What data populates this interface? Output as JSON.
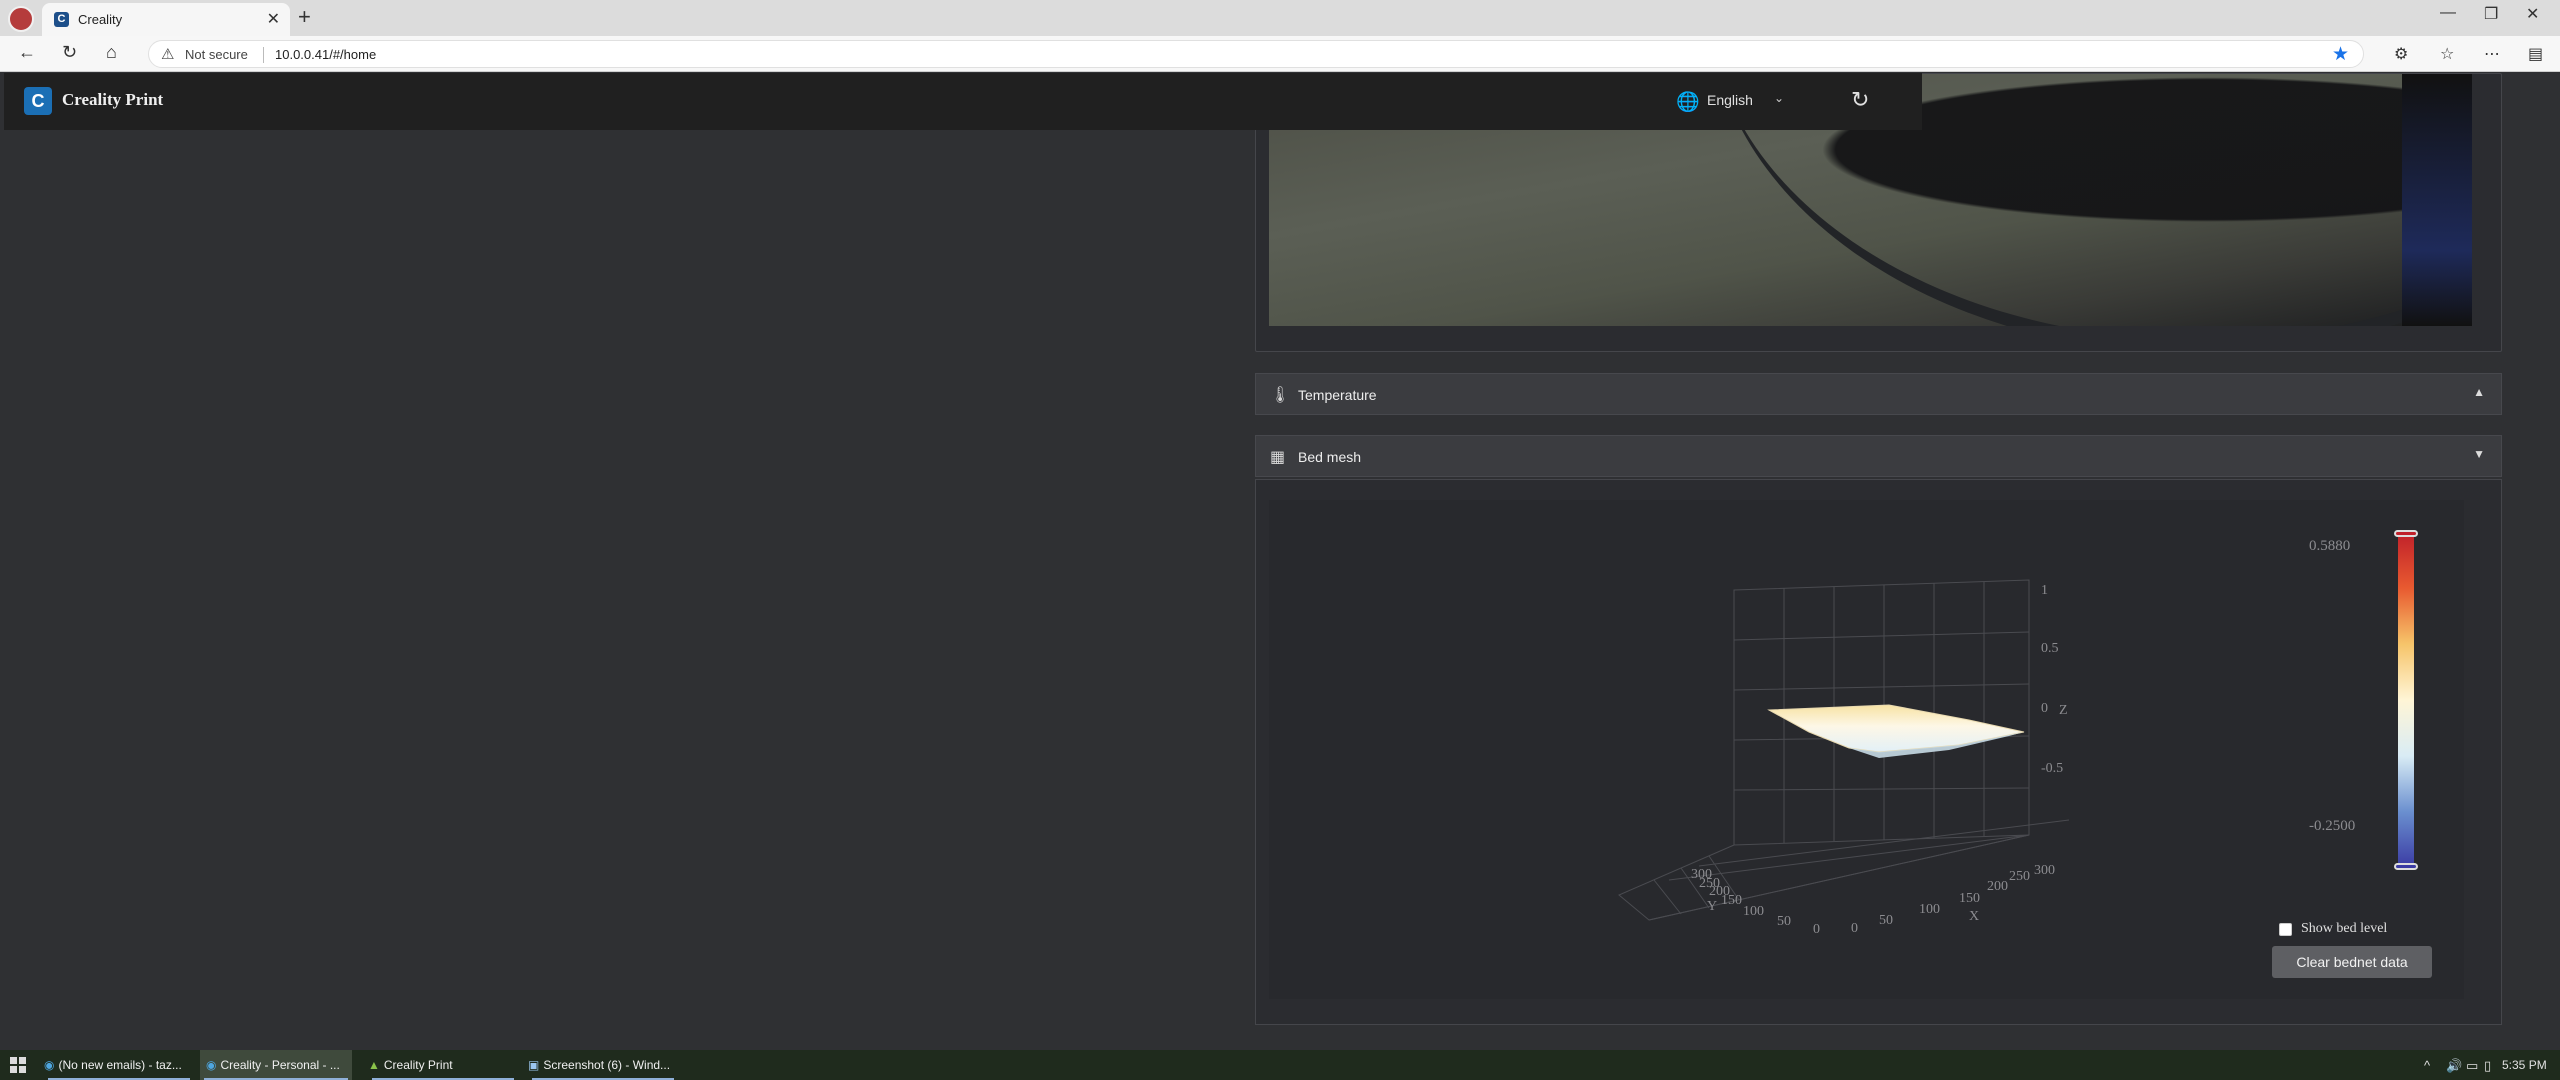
{
  "browser": {
    "tab_title": "Creality",
    "security_label": "Not secure",
    "url": "10.0.0.41/#/home"
  },
  "app": {
    "brand": "Creality Print",
    "language": "English"
  },
  "panels": {
    "temperature_title": "Temperature",
    "bed_mesh_title": "Bed mesh"
  },
  "bed_mesh": {
    "color_max": "0.5880",
    "color_min": "-0.2500",
    "colors": [
      "#c0202a",
      "#e85a30",
      "#f6c46a",
      "#fff5d6",
      "#d9ecf5",
      "#6a8fcf",
      "#3a3aa3"
    ],
    "show_bed_level_label": "Show bed level",
    "show_bed_level_checked": false,
    "clear_button": "Clear bednet data",
    "axes": {
      "z_ticks": [
        "1",
        "0.5",
        "0",
        "-0.5"
      ],
      "z_label": "Z",
      "x_ticks": [
        "0",
        "50",
        "100",
        "150",
        "200",
        "250"
      ],
      "x_label": "X",
      "y_ticks": [
        "0",
        "50",
        "100",
        "150",
        "200",
        "250",
        "300"
      ],
      "y_label": "Y",
      "extra_tick": "300"
    }
  },
  "taskbar": {
    "items": [
      "(No new emails) - taz...",
      "Creality - Personal - ...",
      "Creality Print",
      "Screenshot (6) - Wind..."
    ],
    "time": "5:35 PM"
  }
}
